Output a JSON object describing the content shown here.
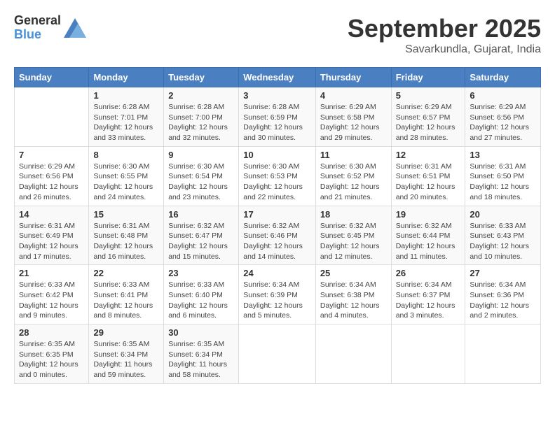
{
  "header": {
    "logo_general": "General",
    "logo_blue": "Blue",
    "month_title": "September 2025",
    "location": "Savarkundla, Gujarat, India"
  },
  "calendar": {
    "weekdays": [
      "Sunday",
      "Monday",
      "Tuesday",
      "Wednesday",
      "Thursday",
      "Friday",
      "Saturday"
    ],
    "weeks": [
      [
        {
          "day": "",
          "info": ""
        },
        {
          "day": "1",
          "info": "Sunrise: 6:28 AM\nSunset: 7:01 PM\nDaylight: 12 hours\nand 33 minutes."
        },
        {
          "day": "2",
          "info": "Sunrise: 6:28 AM\nSunset: 7:00 PM\nDaylight: 12 hours\nand 32 minutes."
        },
        {
          "day": "3",
          "info": "Sunrise: 6:28 AM\nSunset: 6:59 PM\nDaylight: 12 hours\nand 30 minutes."
        },
        {
          "day": "4",
          "info": "Sunrise: 6:29 AM\nSunset: 6:58 PM\nDaylight: 12 hours\nand 29 minutes."
        },
        {
          "day": "5",
          "info": "Sunrise: 6:29 AM\nSunset: 6:57 PM\nDaylight: 12 hours\nand 28 minutes."
        },
        {
          "day": "6",
          "info": "Sunrise: 6:29 AM\nSunset: 6:56 PM\nDaylight: 12 hours\nand 27 minutes."
        }
      ],
      [
        {
          "day": "7",
          "info": "Sunrise: 6:29 AM\nSunset: 6:56 PM\nDaylight: 12 hours\nand 26 minutes."
        },
        {
          "day": "8",
          "info": "Sunrise: 6:30 AM\nSunset: 6:55 PM\nDaylight: 12 hours\nand 24 minutes."
        },
        {
          "day": "9",
          "info": "Sunrise: 6:30 AM\nSunset: 6:54 PM\nDaylight: 12 hours\nand 23 minutes."
        },
        {
          "day": "10",
          "info": "Sunrise: 6:30 AM\nSunset: 6:53 PM\nDaylight: 12 hours\nand 22 minutes."
        },
        {
          "day": "11",
          "info": "Sunrise: 6:30 AM\nSunset: 6:52 PM\nDaylight: 12 hours\nand 21 minutes."
        },
        {
          "day": "12",
          "info": "Sunrise: 6:31 AM\nSunset: 6:51 PM\nDaylight: 12 hours\nand 20 minutes."
        },
        {
          "day": "13",
          "info": "Sunrise: 6:31 AM\nSunset: 6:50 PM\nDaylight: 12 hours\nand 18 minutes."
        }
      ],
      [
        {
          "day": "14",
          "info": "Sunrise: 6:31 AM\nSunset: 6:49 PM\nDaylight: 12 hours\nand 17 minutes."
        },
        {
          "day": "15",
          "info": "Sunrise: 6:31 AM\nSunset: 6:48 PM\nDaylight: 12 hours\nand 16 minutes."
        },
        {
          "day": "16",
          "info": "Sunrise: 6:32 AM\nSunset: 6:47 PM\nDaylight: 12 hours\nand 15 minutes."
        },
        {
          "day": "17",
          "info": "Sunrise: 6:32 AM\nSunset: 6:46 PM\nDaylight: 12 hours\nand 14 minutes."
        },
        {
          "day": "18",
          "info": "Sunrise: 6:32 AM\nSunset: 6:45 PM\nDaylight: 12 hours\nand 12 minutes."
        },
        {
          "day": "19",
          "info": "Sunrise: 6:32 AM\nSunset: 6:44 PM\nDaylight: 12 hours\nand 11 minutes."
        },
        {
          "day": "20",
          "info": "Sunrise: 6:33 AM\nSunset: 6:43 PM\nDaylight: 12 hours\nand 10 minutes."
        }
      ],
      [
        {
          "day": "21",
          "info": "Sunrise: 6:33 AM\nSunset: 6:42 PM\nDaylight: 12 hours\nand 9 minutes."
        },
        {
          "day": "22",
          "info": "Sunrise: 6:33 AM\nSunset: 6:41 PM\nDaylight: 12 hours\nand 8 minutes."
        },
        {
          "day": "23",
          "info": "Sunrise: 6:33 AM\nSunset: 6:40 PM\nDaylight: 12 hours\nand 6 minutes."
        },
        {
          "day": "24",
          "info": "Sunrise: 6:34 AM\nSunset: 6:39 PM\nDaylight: 12 hours\nand 5 minutes."
        },
        {
          "day": "25",
          "info": "Sunrise: 6:34 AM\nSunset: 6:38 PM\nDaylight: 12 hours\nand 4 minutes."
        },
        {
          "day": "26",
          "info": "Sunrise: 6:34 AM\nSunset: 6:37 PM\nDaylight: 12 hours\nand 3 minutes."
        },
        {
          "day": "27",
          "info": "Sunrise: 6:34 AM\nSunset: 6:36 PM\nDaylight: 12 hours\nand 2 minutes."
        }
      ],
      [
        {
          "day": "28",
          "info": "Sunrise: 6:35 AM\nSunset: 6:35 PM\nDaylight: 12 hours\nand 0 minutes."
        },
        {
          "day": "29",
          "info": "Sunrise: 6:35 AM\nSunset: 6:34 PM\nDaylight: 11 hours\nand 59 minutes."
        },
        {
          "day": "30",
          "info": "Sunrise: 6:35 AM\nSunset: 6:34 PM\nDaylight: 11 hours\nand 58 minutes."
        },
        {
          "day": "",
          "info": ""
        },
        {
          "day": "",
          "info": ""
        },
        {
          "day": "",
          "info": ""
        },
        {
          "day": "",
          "info": ""
        }
      ]
    ]
  }
}
